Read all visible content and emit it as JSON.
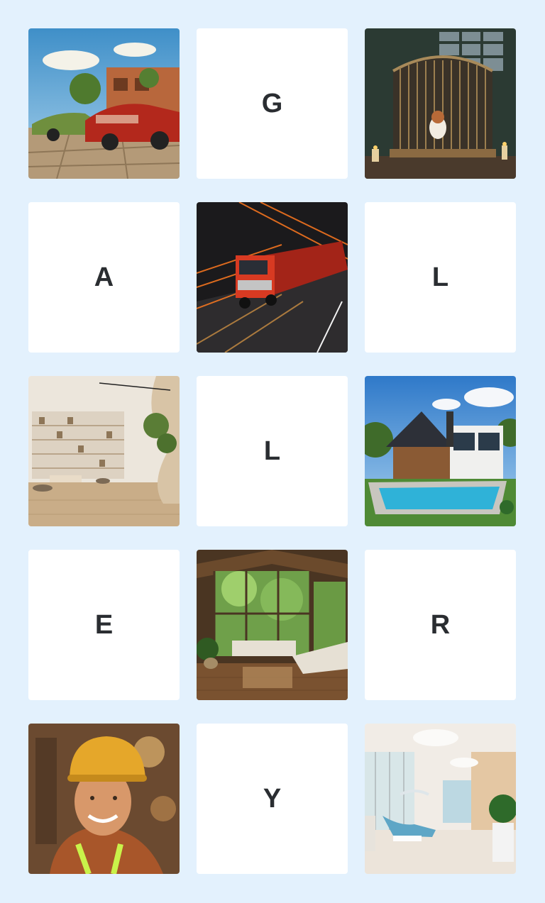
{
  "tiles": [
    {
      "type": "image",
      "icon": "classic-cars-street-image"
    },
    {
      "type": "letter",
      "text": "G"
    },
    {
      "type": "image",
      "icon": "dog-in-cage-image"
    },
    {
      "type": "letter",
      "text": "A"
    },
    {
      "type": "image",
      "icon": "red-truck-motion-image"
    },
    {
      "type": "letter",
      "text": "L"
    },
    {
      "type": "image",
      "icon": "shop-interior-image"
    },
    {
      "type": "letter",
      "text": "L"
    },
    {
      "type": "image",
      "icon": "modern-house-pool-image"
    },
    {
      "type": "letter",
      "text": "E"
    },
    {
      "type": "image",
      "icon": "forest-living-room-image"
    },
    {
      "type": "letter",
      "text": "R"
    },
    {
      "type": "image",
      "icon": "smiling-worker-helmet-image"
    },
    {
      "type": "letter",
      "text": "Y"
    },
    {
      "type": "image",
      "icon": "dental-clinic-image"
    }
  ],
  "colors": {
    "background": "#e3f1fd",
    "tile": "#ffffff",
    "letter": "#2a2d31"
  }
}
